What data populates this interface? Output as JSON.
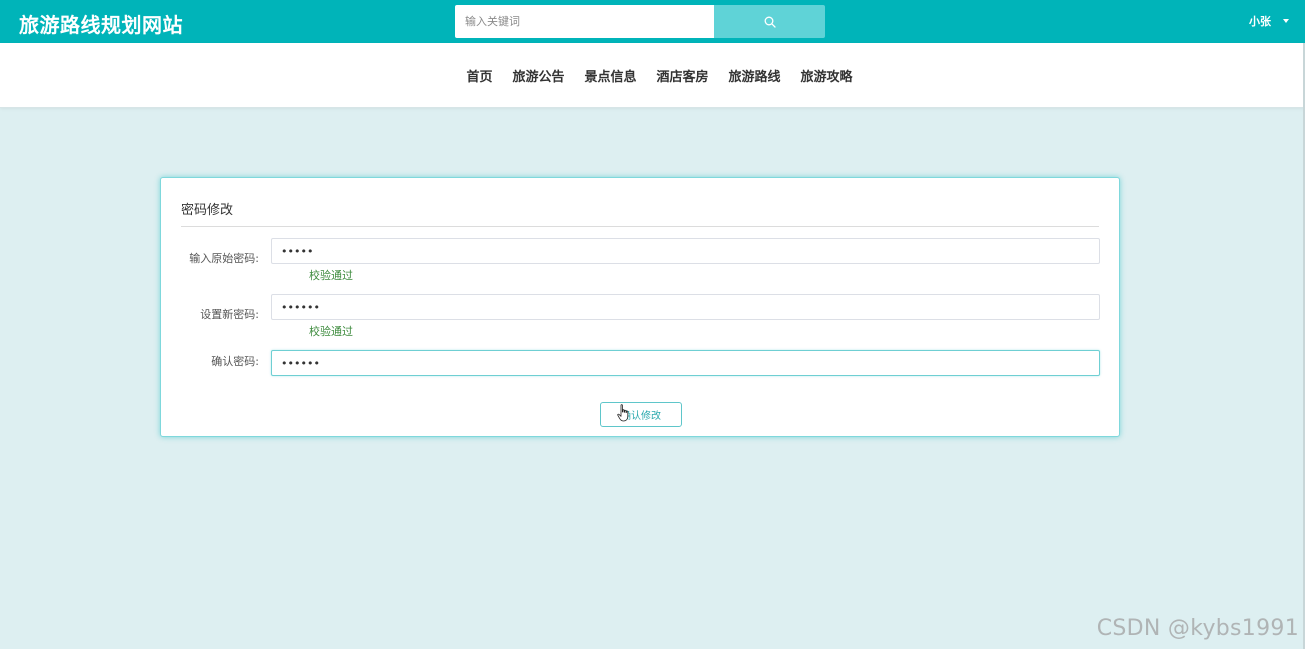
{
  "header": {
    "site_title": "旅游路线规划网站",
    "search": {
      "placeholder": "输入关键词",
      "value": ""
    },
    "search_button_icon": "search-icon",
    "user_name": "小张",
    "brand_color": "#00b4b9"
  },
  "nav": {
    "items": [
      {
        "label": "首页"
      },
      {
        "label": "旅游公告"
      },
      {
        "label": "景点信息"
      },
      {
        "label": "酒店客房"
      },
      {
        "label": "旅游路线"
      },
      {
        "label": "旅游攻略"
      }
    ]
  },
  "form": {
    "title": "密码修改",
    "fields": [
      {
        "label": "输入原始密码:",
        "value": "•••••",
        "validation": "校验通过"
      },
      {
        "label": "设置新密码:",
        "value": "••••••",
        "validation": "校验通过"
      },
      {
        "label": "确认密码:",
        "value": "••••••",
        "validation": ""
      }
    ],
    "submit_label": "确认修改",
    "valid_color": "#3d8b3d"
  },
  "watermark": "CSDN @kybs1991"
}
